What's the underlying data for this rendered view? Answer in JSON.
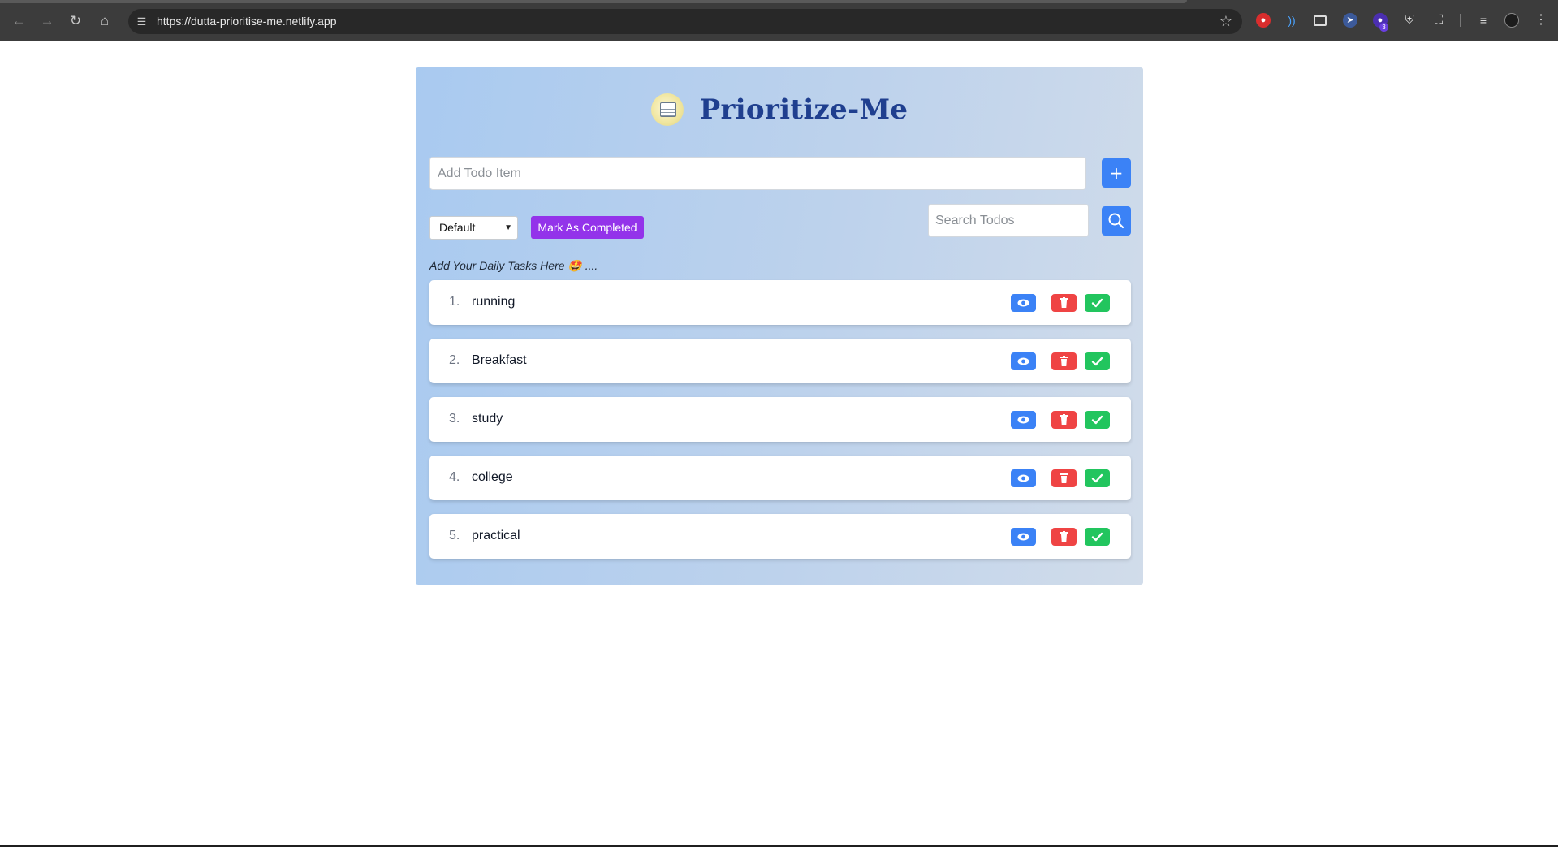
{
  "browser": {
    "url": "https://dutta-prioritise-me.netlify.app",
    "extension_badge": "3"
  },
  "app": {
    "title": "Prioritize-Me",
    "add_placeholder": "Add Todo Item",
    "add_label": "+",
    "sort_value": "Default",
    "mark_completed_label": "Mark As Completed",
    "search_placeholder": "Search Todos",
    "hint": "Add Your Daily Tasks Here 🤩 ....",
    "todos": [
      {
        "num": "1.",
        "text": "running"
      },
      {
        "num": "2.",
        "text": "Breakfast"
      },
      {
        "num": "3.",
        "text": "study"
      },
      {
        "num": "4.",
        "text": "college"
      },
      {
        "num": "5.",
        "text": "practical"
      }
    ]
  },
  "colors": {
    "primary": "#3b82f6",
    "danger": "#ef4444",
    "success": "#22c55e",
    "accent": "#9333ea",
    "title": "#1f3f8f"
  }
}
